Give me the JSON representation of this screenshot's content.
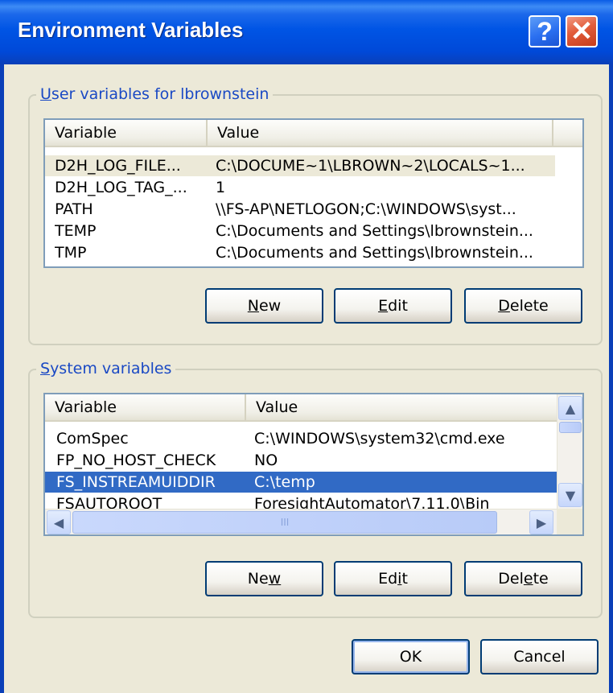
{
  "window": {
    "title": "Environment Variables",
    "help_glyph": "?",
    "close_glyph": "✕"
  },
  "user_group": {
    "label_prefix": "U",
    "label_rest": "ser variables for lbrownstein",
    "columns": [
      "Variable",
      "Value"
    ],
    "rows": [
      {
        "variable": "D2H_LOG_FILE...",
        "value": "C:\\DOCUME~1\\LBROWN~2\\LOCALS~1..."
      },
      {
        "variable": "D2H_LOG_TAG_...",
        "value": "1"
      },
      {
        "variable": "PATH",
        "value": "\\\\FS-AP\\NETLOGON;C:\\WINDOWS\\syst..."
      },
      {
        "variable": "TEMP",
        "value": "C:\\Documents and Settings\\lbrownstein..."
      },
      {
        "variable": "TMP",
        "value": "C:\\Documents and Settings\\lbrownstein..."
      }
    ],
    "selected_row": 0,
    "buttons": {
      "new": {
        "ul": "N",
        "rest": "ew"
      },
      "edit": {
        "ul": "E",
        "rest": "dit"
      },
      "delete": {
        "ul": "D",
        "rest": "elete"
      }
    }
  },
  "system_group": {
    "label_prefix": "S",
    "label_rest": "ystem variables",
    "columns": [
      "Variable",
      "Value"
    ],
    "rows": [
      {
        "variable": "ComSpec",
        "value": "C:\\WINDOWS\\system32\\cmd.exe"
      },
      {
        "variable": "FP_NO_HOST_CHECK",
        "value": "NO"
      },
      {
        "variable": "FS_INSTREAMUIDDIR",
        "value": "C:\\temp"
      },
      {
        "variable": "FSAUTOROOT",
        "value": "ForesightAutomator\\7.11.0\\Bin"
      }
    ],
    "selected_row": 2,
    "buttons": {
      "new": {
        "pre": "Ne",
        "ul": "w",
        "rest": ""
      },
      "edit": {
        "pre": "Ed",
        "ul": "i",
        "rest": "t"
      },
      "delete": {
        "pre": "Del",
        "ul": "e",
        "rest": "te"
      }
    },
    "scroll_arrows": {
      "up": "▲",
      "down": "▼",
      "left": "◀",
      "right": "▶"
    },
    "thumb_grip": "III"
  },
  "dialog_buttons": {
    "ok": "OK",
    "cancel": "Cancel"
  }
}
